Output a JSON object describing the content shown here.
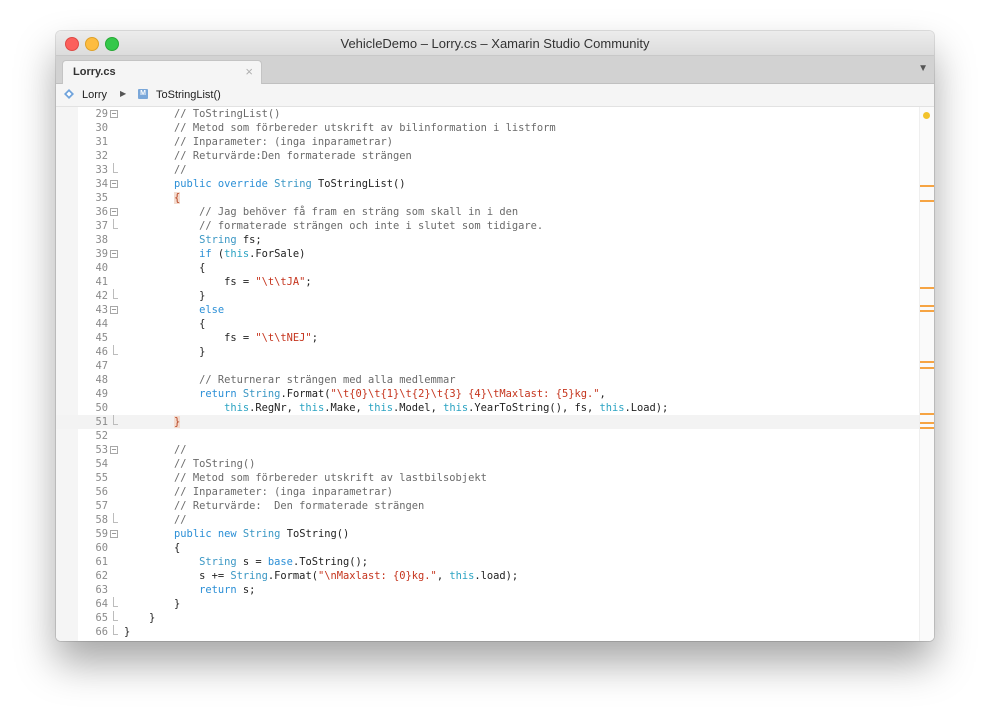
{
  "window": {
    "title": "VehicleDemo – Lorry.cs – Xamarin Studio Community"
  },
  "tabs": [
    {
      "label": "Lorry.cs",
      "close_glyph": "×"
    }
  ],
  "tab_menu_glyph": "▼",
  "breadcrumb": {
    "class_name": "Lorry",
    "separator": "▶",
    "method_badge": "M",
    "method_name": "ToStringList()"
  },
  "icons": {
    "class_icon": "class-diamond-icon",
    "method_icon": "method-icon",
    "close_icon": "close-icon",
    "dropdown_icon": "chevron-down-icon"
  },
  "colors": {
    "keyword": "#2b8fd6",
    "string": "#c5341d",
    "comment": "#6a6a6a",
    "marker": "#f6a443",
    "warning_dot": "#f2c32c"
  },
  "current_line": 51,
  "code": [
    {
      "n": "29",
      "fold": "minus",
      "tokens": [
        [
          "",
          "        "
        ],
        [
          "cmt",
          "// ToStringList()"
        ]
      ]
    },
    {
      "n": "30",
      "fold": "",
      "tokens": [
        [
          "",
          "        "
        ],
        [
          "cmt",
          "// Metod som förbereder utskrift av bilinformation i listform"
        ]
      ]
    },
    {
      "n": "31",
      "fold": "",
      "tokens": [
        [
          "",
          "        "
        ],
        [
          "cmt",
          "// Inparameter: (inga inparametrar)"
        ]
      ]
    },
    {
      "n": "32",
      "fold": "",
      "tokens": [
        [
          "",
          "        "
        ],
        [
          "cmt",
          "// Returvärde:Den formaterade strängen"
        ]
      ]
    },
    {
      "n": "33",
      "fold": "end",
      "tokens": [
        [
          "",
          "        "
        ],
        [
          "cmt",
          "//"
        ]
      ]
    },
    {
      "n": "34",
      "fold": "minus",
      "tokens": [
        [
          "",
          "        "
        ],
        [
          "kw",
          "public"
        ],
        [
          "",
          " "
        ],
        [
          "kw",
          "override"
        ],
        [
          "",
          " "
        ],
        [
          "ty",
          "String"
        ],
        [
          "",
          " ToStringList()"
        ]
      ]
    },
    {
      "n": "35",
      "fold": "",
      "tokens": [
        [
          "",
          "        "
        ],
        [
          "br",
          "{"
        ]
      ]
    },
    {
      "n": "36",
      "fold": "minus",
      "tokens": [
        [
          "",
          "            "
        ],
        [
          "cmt",
          "// Jag behöver få fram en sträng som skall in i den"
        ]
      ]
    },
    {
      "n": "37",
      "fold": "end",
      "tokens": [
        [
          "",
          "            "
        ],
        [
          "cmt",
          "// formaterade strängen och inte i slutet som tidigare."
        ]
      ]
    },
    {
      "n": "38",
      "fold": "",
      "tokens": [
        [
          "",
          "            "
        ],
        [
          "ty",
          "String"
        ],
        [
          "",
          " fs;"
        ]
      ]
    },
    {
      "n": "39",
      "fold": "minus",
      "tokens": [
        [
          "",
          "            "
        ],
        [
          "kw",
          "if"
        ],
        [
          "",
          " ("
        ],
        [
          "thisk",
          "this"
        ],
        [
          "",
          ".ForSale)"
        ]
      ]
    },
    {
      "n": "40",
      "fold": "",
      "tokens": [
        [
          "",
          "            {"
        ]
      ]
    },
    {
      "n": "41",
      "fold": "",
      "tokens": [
        [
          "",
          "                fs = "
        ],
        [
          "str",
          "\"\\t\\tJA\""
        ],
        [
          "",
          ";"
        ]
      ]
    },
    {
      "n": "42",
      "fold": "end",
      "tokens": [
        [
          "",
          "            }"
        ]
      ]
    },
    {
      "n": "43",
      "fold": "minus",
      "tokens": [
        [
          "",
          "            "
        ],
        [
          "kw",
          "else"
        ]
      ]
    },
    {
      "n": "44",
      "fold": "",
      "tokens": [
        [
          "",
          "            {"
        ]
      ]
    },
    {
      "n": "45",
      "fold": "",
      "tokens": [
        [
          "",
          "                fs = "
        ],
        [
          "str",
          "\"\\t\\tNEJ\""
        ],
        [
          "",
          ";"
        ]
      ]
    },
    {
      "n": "46",
      "fold": "end",
      "tokens": [
        [
          "",
          "            }"
        ]
      ]
    },
    {
      "n": "47",
      "fold": "",
      "tokens": [
        [
          "",
          ""
        ]
      ]
    },
    {
      "n": "48",
      "fold": "",
      "tokens": [
        [
          "",
          "            "
        ],
        [
          "cmt",
          "// Returnerar strängen med alla medlemmar"
        ]
      ]
    },
    {
      "n": "49",
      "fold": "",
      "tokens": [
        [
          "",
          "            "
        ],
        [
          "kw",
          "return"
        ],
        [
          "",
          " "
        ],
        [
          "ty",
          "String"
        ],
        [
          "",
          ".Format("
        ],
        [
          "str",
          "\"\\t{0}\\t{1}\\t{2}\\t{3} {4}\\tMaxlast: {5}kg.\""
        ],
        [
          "",
          ","
        ]
      ]
    },
    {
      "n": "50",
      "fold": "",
      "tokens": [
        [
          "",
          "                "
        ],
        [
          "thisk",
          "this"
        ],
        [
          "",
          ".RegNr, "
        ],
        [
          "thisk",
          "this"
        ],
        [
          "",
          ".Make, "
        ],
        [
          "thisk",
          "this"
        ],
        [
          "",
          ".Model, "
        ],
        [
          "thisk",
          "this"
        ],
        [
          "",
          ".YearToString(), fs, "
        ],
        [
          "thisk",
          "this"
        ],
        [
          "",
          ".Load);"
        ]
      ]
    },
    {
      "n": "51",
      "fold": "end",
      "tokens": [
        [
          "",
          "        "
        ],
        [
          "br",
          "}"
        ]
      ]
    },
    {
      "n": "52",
      "fold": "",
      "tokens": [
        [
          "",
          ""
        ]
      ]
    },
    {
      "n": "53",
      "fold": "minus",
      "tokens": [
        [
          "",
          "        "
        ],
        [
          "cmt",
          "//"
        ]
      ]
    },
    {
      "n": "54",
      "fold": "",
      "tokens": [
        [
          "",
          "        "
        ],
        [
          "cmt",
          "// ToString()"
        ]
      ]
    },
    {
      "n": "55",
      "fold": "",
      "tokens": [
        [
          "",
          "        "
        ],
        [
          "cmt",
          "// Metod som förbereder utskrift av lastbilsobjekt"
        ]
      ]
    },
    {
      "n": "56",
      "fold": "",
      "tokens": [
        [
          "",
          "        "
        ],
        [
          "cmt",
          "// Inparameter: (inga inparametrar)"
        ]
      ]
    },
    {
      "n": "57",
      "fold": "",
      "tokens": [
        [
          "",
          "        "
        ],
        [
          "cmt",
          "// Returvärde:  Den formaterade strängen"
        ]
      ]
    },
    {
      "n": "58",
      "fold": "end",
      "tokens": [
        [
          "",
          "        "
        ],
        [
          "cmt",
          "//"
        ]
      ]
    },
    {
      "n": "59",
      "fold": "minus",
      "tokens": [
        [
          "",
          "        "
        ],
        [
          "kw",
          "public"
        ],
        [
          "",
          " "
        ],
        [
          "kw",
          "new"
        ],
        [
          "",
          " "
        ],
        [
          "ty",
          "String"
        ],
        [
          "",
          " ToString()"
        ]
      ]
    },
    {
      "n": "60",
      "fold": "",
      "tokens": [
        [
          "",
          "        {"
        ]
      ]
    },
    {
      "n": "61",
      "fold": "",
      "tokens": [
        [
          "",
          "            "
        ],
        [
          "ty",
          "String"
        ],
        [
          "",
          " s = "
        ],
        [
          "kw",
          "base"
        ],
        [
          "",
          ".ToString();"
        ]
      ]
    },
    {
      "n": "62",
      "fold": "",
      "tokens": [
        [
          "",
          "            s += "
        ],
        [
          "ty",
          "String"
        ],
        [
          "",
          ".Format("
        ],
        [
          "str",
          "\"\\nMaxlast: {0}kg.\""
        ],
        [
          "",
          ", "
        ],
        [
          "thisk",
          "this"
        ],
        [
          "",
          ".load);"
        ]
      ]
    },
    {
      "n": "63",
      "fold": "",
      "tokens": [
        [
          "",
          "            "
        ],
        [
          "kw",
          "return"
        ],
        [
          "",
          " s;"
        ]
      ]
    },
    {
      "n": "64",
      "fold": "end",
      "tokens": [
        [
          "",
          "        }"
        ]
      ]
    },
    {
      "n": "65",
      "fold": "end",
      "tokens": [
        [
          "",
          "    }"
        ]
      ]
    },
    {
      "n": "66",
      "fold": "end",
      "tokens": [
        [
          "",
          "}"
        ]
      ]
    }
  ]
}
